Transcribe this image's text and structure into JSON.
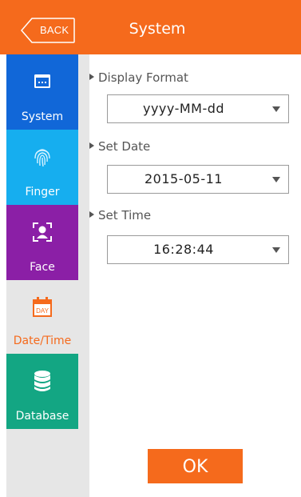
{
  "header": {
    "back_label": "BACK",
    "title": "System"
  },
  "sidebar": {
    "items": [
      {
        "label": "System",
        "icon": "window-icon",
        "color": "#1167d8"
      },
      {
        "label": "Finger",
        "icon": "fingerprint-icon",
        "color": "#16aeef"
      },
      {
        "label": "Face",
        "icon": "face-scan-icon",
        "color": "#8b1fa6"
      },
      {
        "label": "Date/Time",
        "icon": "calendar-icon",
        "icon_text": "DAY",
        "color": "#f56a1c",
        "selected": true
      },
      {
        "label": "Database",
        "icon": "database-icon",
        "color": "#13a683"
      }
    ]
  },
  "settings": {
    "display_format": {
      "label": "Display Format",
      "value": "yyyy-MM-dd"
    },
    "set_date": {
      "label": "Set Date",
      "value": "2015-05-11"
    },
    "set_time": {
      "label": "Set Time",
      "value": "16:28:44"
    }
  },
  "ok_label": "OK",
  "colors": {
    "accent": "#f56a1c",
    "sidebar_bg": "#e6e6e6"
  }
}
